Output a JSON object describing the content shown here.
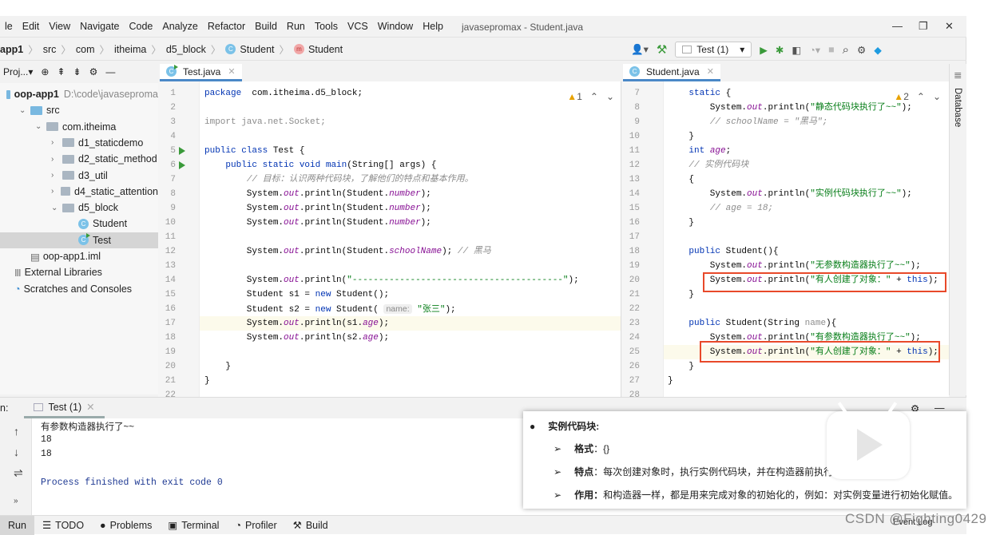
{
  "menu": [
    "le",
    "Edit",
    "View",
    "Navigate",
    "Code",
    "Analyze",
    "Refactor",
    "Build",
    "Run",
    "Tools",
    "VCS",
    "Window",
    "Help"
  ],
  "window_title": "javasepromax - Student.java",
  "breadcrumb": [
    "app1",
    "src",
    "com",
    "itheima",
    "d5_block",
    "Student",
    "Student"
  ],
  "toolbar": {
    "run_config": "Test (1)"
  },
  "project_tool": {
    "label": "Proj..."
  },
  "tree": [
    {
      "label": "oop-app1",
      "path": "D:\\code\\javaseproma",
      "type": "module",
      "depth": 0,
      "arrow": ""
    },
    {
      "label": "src",
      "type": "src",
      "depth": 1,
      "arrow": "⌄"
    },
    {
      "label": "com.itheima",
      "type": "folder",
      "depth": 2,
      "arrow": "⌄"
    },
    {
      "label": "d1_staticdemo",
      "type": "folder",
      "depth": 3,
      "arrow": "›"
    },
    {
      "label": "d2_static_method",
      "type": "folder",
      "depth": 3,
      "arrow": "›"
    },
    {
      "label": "d3_util",
      "type": "folder",
      "depth": 3,
      "arrow": "›"
    },
    {
      "label": "d4_static_attention",
      "type": "folder",
      "depth": 3,
      "arrow": "›"
    },
    {
      "label": "d5_block",
      "type": "folder",
      "depth": 3,
      "arrow": "⌄"
    },
    {
      "label": "Student",
      "type": "class",
      "depth": 4,
      "arrow": ""
    },
    {
      "label": "Test",
      "type": "class-run",
      "depth": 4,
      "arrow": "",
      "selected": true
    },
    {
      "label": "oop-app1.iml",
      "type": "file",
      "depth": 1,
      "arrow": ""
    },
    {
      "label": "External Libraries",
      "type": "lib",
      "depth": 0,
      "arrow": ""
    },
    {
      "label": "Scratches and Consoles",
      "type": "scratch",
      "depth": 0,
      "arrow": ""
    }
  ],
  "left_editor": {
    "tab": "Test.java",
    "warnings": "1",
    "start": 1,
    "highlight": 17,
    "run_lines": [
      5,
      6
    ],
    "lines": [
      [
        [
          "kw",
          "package"
        ],
        [
          "",
          "  com.itheima.d5_block;"
        ]
      ],
      [],
      [
        [
          "gr",
          "import java.net.Socket;"
        ]
      ],
      [],
      [
        [
          "kw",
          "public class"
        ],
        [
          "",
          " Test {"
        ]
      ],
      [
        [
          "",
          "    "
        ],
        [
          "kw",
          "public static void"
        ],
        [
          "",
          " "
        ],
        [
          "kw",
          "main"
        ],
        [
          "",
          "(String[] args) {"
        ]
      ],
      [
        [
          "",
          "        "
        ],
        [
          "cm",
          "// 目标：认识两种代码块，了解他们的特点和基本作用。"
        ]
      ],
      [
        [
          "",
          "        System."
        ],
        [
          "fld",
          "out"
        ],
        [
          "",
          ".println(Student."
        ],
        [
          "fld",
          "number"
        ],
        [
          "",
          ");"
        ]
      ],
      [
        [
          "",
          "        System."
        ],
        [
          "fld",
          "out"
        ],
        [
          "",
          ".println(Student."
        ],
        [
          "fld",
          "number"
        ],
        [
          "",
          ");"
        ]
      ],
      [
        [
          "",
          "        System."
        ],
        [
          "fld",
          "out"
        ],
        [
          "",
          ".println(Student."
        ],
        [
          "fld",
          "number"
        ],
        [
          "",
          ");"
        ]
      ],
      [],
      [
        [
          "",
          "        System."
        ],
        [
          "fld",
          "out"
        ],
        [
          "",
          ".println(Student."
        ],
        [
          "fld",
          "schoolName"
        ],
        [
          "",
          "); "
        ],
        [
          "cm",
          "// 黑马"
        ]
      ],
      [],
      [
        [
          "",
          "        System."
        ],
        [
          "fld",
          "out"
        ],
        [
          "",
          ".println("
        ],
        [
          "str",
          "\"----------------------------------------\""
        ],
        [
          "",
          ");"
        ]
      ],
      [
        [
          "",
          "        Student s1 = "
        ],
        [
          "kw",
          "new"
        ],
        [
          "",
          " Student();"
        ]
      ],
      [
        [
          "",
          "        Student s2 = "
        ],
        [
          "kw",
          "new"
        ],
        [
          "",
          " Student( "
        ],
        [
          "hint",
          "name:"
        ],
        [
          "str",
          " \"张三\""
        ],
        [
          "",
          ");"
        ]
      ],
      [
        [
          "",
          "        System."
        ],
        [
          "fld",
          "out"
        ],
        [
          "",
          ".println(s1."
        ],
        [
          "fld",
          "age"
        ],
        [
          "",
          ");"
        ]
      ],
      [
        [
          "",
          "        System."
        ],
        [
          "fld",
          "out"
        ],
        [
          "",
          ".println(s2."
        ],
        [
          "fld",
          "age"
        ],
        [
          "",
          ");"
        ]
      ],
      [],
      [
        [
          "",
          "    }"
        ]
      ],
      [
        [
          "",
          "}"
        ]
      ],
      []
    ]
  },
  "right_editor": {
    "tab": "Student.java",
    "warnings": "2",
    "start": 7,
    "highlight": 25,
    "lines": [
      [
        [
          "",
          "    "
        ],
        [
          "kw",
          "static"
        ],
        [
          "",
          " {"
        ]
      ],
      [
        [
          "",
          "        System."
        ],
        [
          "fld",
          "out"
        ],
        [
          "",
          ".println("
        ],
        [
          "str",
          "\"静态代码块执行了~~\""
        ],
        [
          "",
          ");"
        ]
      ],
      [
        [
          "",
          "        "
        ],
        [
          "cm",
          "// schoolName = \"黑马\";"
        ]
      ],
      [
        [
          "",
          "    }"
        ]
      ],
      [
        [
          "",
          "    "
        ],
        [
          "kw",
          "int"
        ],
        [
          "",
          " "
        ],
        [
          "fld",
          "age"
        ],
        [
          "",
          ";"
        ]
      ],
      [
        [
          "",
          "    "
        ],
        [
          "cm",
          "// 实例代码块"
        ]
      ],
      [
        [
          "",
          "    {"
        ]
      ],
      [
        [
          "",
          "        System."
        ],
        [
          "fld",
          "out"
        ],
        [
          "",
          ".println("
        ],
        [
          "str",
          "\"实例代码块执行了~~\""
        ],
        [
          "",
          ");"
        ]
      ],
      [
        [
          "",
          "        "
        ],
        [
          "cm",
          "// age = 18;"
        ]
      ],
      [
        [
          "",
          "    }"
        ]
      ],
      [],
      [
        [
          "",
          "    "
        ],
        [
          "kw",
          "public"
        ],
        [
          "",
          " Student(){"
        ]
      ],
      [
        [
          "",
          "        System."
        ],
        [
          "fld",
          "out"
        ],
        [
          "",
          ".println("
        ],
        [
          "str",
          "\"无参数构造器执行了~~\""
        ],
        [
          "",
          ");"
        ]
      ],
      [
        [
          "",
          "        System."
        ],
        [
          "fld",
          "out"
        ],
        [
          "",
          ".println("
        ],
        [
          "str",
          "\"有人创建了对象：\""
        ],
        [
          "",
          " + "
        ],
        [
          "kw",
          "this"
        ],
        [
          "",
          ");"
        ]
      ],
      [
        [
          "",
          "    }"
        ]
      ],
      [],
      [
        [
          "",
          "    "
        ],
        [
          "kw",
          "public"
        ],
        [
          "",
          " Student(String "
        ],
        [
          "gr",
          "name"
        ],
        [
          "",
          "){"
        ]
      ],
      [
        [
          "",
          "        System."
        ],
        [
          "fld",
          "out"
        ],
        [
          "",
          ".println("
        ],
        [
          "str",
          "\"有参数构造器执行了~~\""
        ],
        [
          "",
          ");"
        ]
      ],
      [
        [
          "",
          "        System."
        ],
        [
          "fld",
          "out"
        ],
        [
          "",
          ".println("
        ],
        [
          "str",
          "\"有人创建了对象：\""
        ],
        [
          "",
          " + "
        ],
        [
          "kw",
          "this"
        ],
        [
          "",
          ");"
        ]
      ],
      [
        [
          "",
          "    }"
        ]
      ],
      [
        [
          "",
          "}"
        ]
      ],
      []
    ]
  },
  "database_label": "Database",
  "run_panel": {
    "prefix": "n:",
    "tab": "Test (1)",
    "output": [
      "有参数构造器执行了~~",
      "18",
      "18",
      "",
      "Process finished with exit code 0"
    ]
  },
  "bottom_tools": [
    "Run",
    "TODO",
    "Problems",
    "Terminal",
    "Profiler",
    "Build"
  ],
  "event_log": "Event Log",
  "popup": {
    "title": "实例代码块:",
    "items": [
      {
        "k": "格式",
        "v": "：{}"
      },
      {
        "k": "特点",
        "v": "：每次创建对象时，执行实例代码块，并在构造器前执行。"
      },
      {
        "k": "作用：",
        "v": "和构造器一样，都是用来完成对象的初始化的，例如：对实例变量进行初始化赋值。"
      }
    ]
  },
  "watermark": "CSDN @Fighting0429",
  "colors": {
    "keyword": "#0033b3",
    "field": "#871094",
    "string": "#067d17",
    "comment": "#8c8c8c",
    "highlight_box": "#e8492a",
    "run": "#3a9a3a"
  }
}
